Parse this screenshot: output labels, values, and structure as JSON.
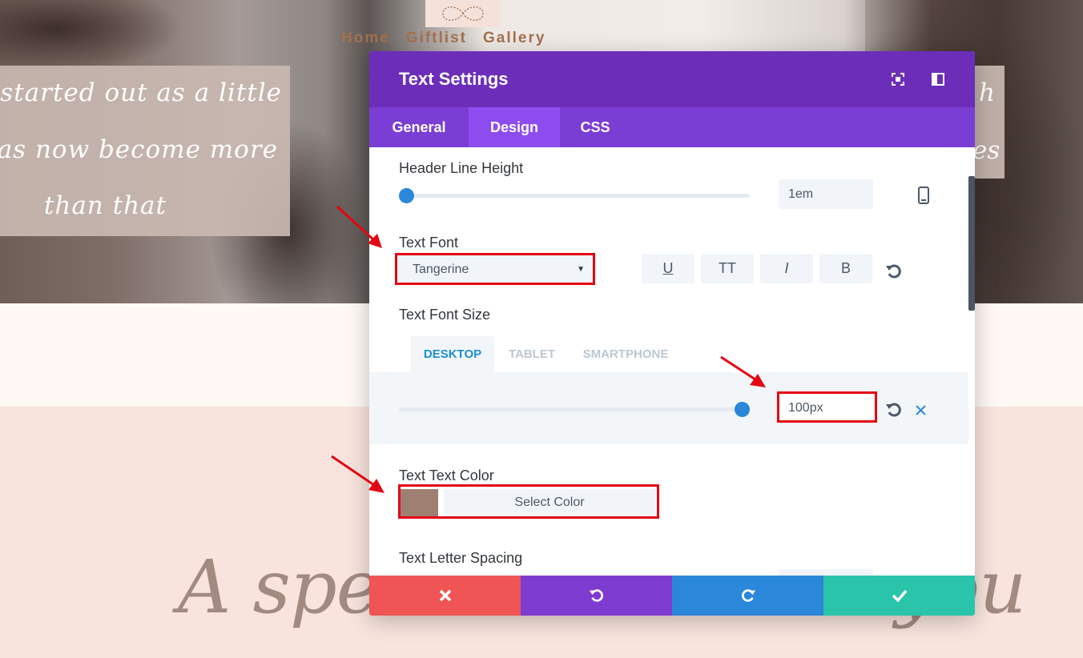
{
  "site": {
    "nav": [
      "Home",
      "Giftlist",
      "Gallery"
    ],
    "quote_left": [
      "t started out as a little",
      "has now become more",
      "than that"
    ],
    "quote_right": [
      "h",
      "es"
    ],
    "big_script": "A special thanks to you"
  },
  "modal": {
    "title": "Text Settings",
    "tabs": [
      "General",
      "Design",
      "CSS"
    ],
    "active_tab": "Design",
    "header_line_height": {
      "label": "Header Line Height",
      "value": "1em"
    },
    "text_font": {
      "label": "Text Font",
      "value": "Tangerine",
      "style_buttons": [
        "U",
        "TT",
        "I",
        "B"
      ]
    },
    "text_font_size": {
      "label": "Text Font Size",
      "device_tabs": [
        "DESKTOP",
        "TABLET",
        "SMARTPHONE"
      ],
      "active_device": "DESKTOP",
      "value": "100px"
    },
    "text_color": {
      "label": "Text Text Color",
      "button": "Select Color",
      "swatch": "#9e8073"
    },
    "letter_spacing": {
      "label": "Text Letter Spacing"
    }
  },
  "colors": {
    "header": "#6c2eb9",
    "tabs": "#7b3ed4",
    "close": "#ef5555",
    "undo": "#7e3bd0",
    "redo": "#2b87da",
    "save": "#29c4a9",
    "highlight": "#e30613"
  }
}
